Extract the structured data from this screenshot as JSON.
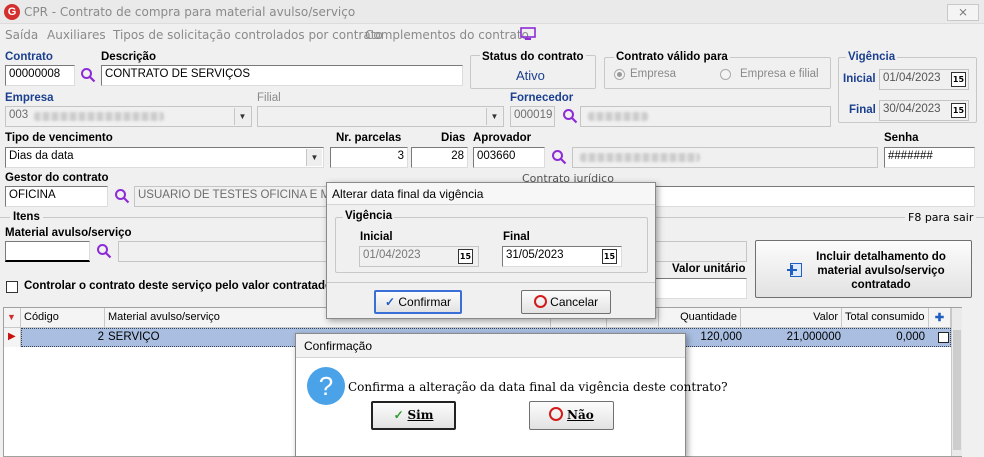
{
  "window": {
    "app_code": "CPR",
    "title": "CPR - Contrato de compra para material avulso/serviço",
    "close_glyph": "⨯"
  },
  "menu": {
    "items": [
      "Saída",
      "Auxiliares",
      "Tipos de solicitação controlados por contrato",
      "Complementos do contrato"
    ]
  },
  "contrato": {
    "label": "Contrato",
    "value": "00000008"
  },
  "descricao": {
    "label": "Descrição",
    "value": "CONTRATO DE SERVIÇOS"
  },
  "status": {
    "label": "Status do contrato",
    "value": "Ativo"
  },
  "valido_para": {
    "label": "Contrato válido para",
    "opt1": "Empresa",
    "opt2": "Empresa e filial",
    "selected": "Empresa"
  },
  "vigencia": {
    "label": "Vigência",
    "inicial_label": "Inicial",
    "inicial": "01/04/2023",
    "final_label": "Final",
    "final": "30/04/2023"
  },
  "empresa": {
    "label": "Empresa",
    "value": "003"
  },
  "filial": {
    "label": "Filial",
    "value": ""
  },
  "fornecedor": {
    "label": "Fornecedor",
    "value": "000019"
  },
  "tipo_venc": {
    "label": "Tipo de vencimento",
    "value": "Dias da data"
  },
  "parcelas": {
    "label": "Nr. parcelas",
    "value": "3"
  },
  "dias": {
    "label": "Dias",
    "value": "28"
  },
  "aprovador": {
    "label": "Aprovador",
    "value": "003660"
  },
  "senha": {
    "label": "Senha",
    "value": "#######"
  },
  "gestor": {
    "label": "Gestor do contrato",
    "value": "OFICINA",
    "name": "USUARIO DE TESTES OFICINA E MA"
  },
  "contrato_juridico": {
    "label": "Contrato jurídico"
  },
  "itens": {
    "label": "Itens",
    "hint": "F8 para sair",
    "material_label": "Material avulso/serviço",
    "material_value": "",
    "valor_unitario_label": "Valor unitário",
    "valor_unitario_value": ""
  },
  "controlar": {
    "label": "Controlar o contrato deste serviço pelo valor contratado",
    "checked": false
  },
  "incluir_btn": {
    "label": "Incluir detalhamento do material avulso/serviço contratado"
  },
  "grid": {
    "columns": [
      "Código",
      "Material avulso/serviço",
      "",
      "",
      "Quantidade",
      "Valor",
      "Total consumido",
      ""
    ],
    "rows": [
      {
        "codigo": "2",
        "material": "SERVIÇO",
        "quantidade": "120,000",
        "valor": "21,000000",
        "total": "0,000",
        "checked": false
      }
    ]
  },
  "dialog_vigencia": {
    "title": "Alterar data final da vigência",
    "group": "Vigência",
    "inicial_label": "Inicial",
    "inicial": "01/04/2023",
    "final_label": "Final",
    "final": "31/05/2023",
    "confirm": "Confirmar",
    "cancel": "Cancelar"
  },
  "dialog_confirm": {
    "title": "Confirmação",
    "message": "Confirma a alteração da data final da vigência deste contrato?",
    "yes": "Sim",
    "no": "Não"
  },
  "colors": {
    "accent_blue": "#1b3f8f",
    "selected_row": "#a9bee0",
    "error_red": "#d31a1a",
    "check_green": "#2e9c2e"
  }
}
